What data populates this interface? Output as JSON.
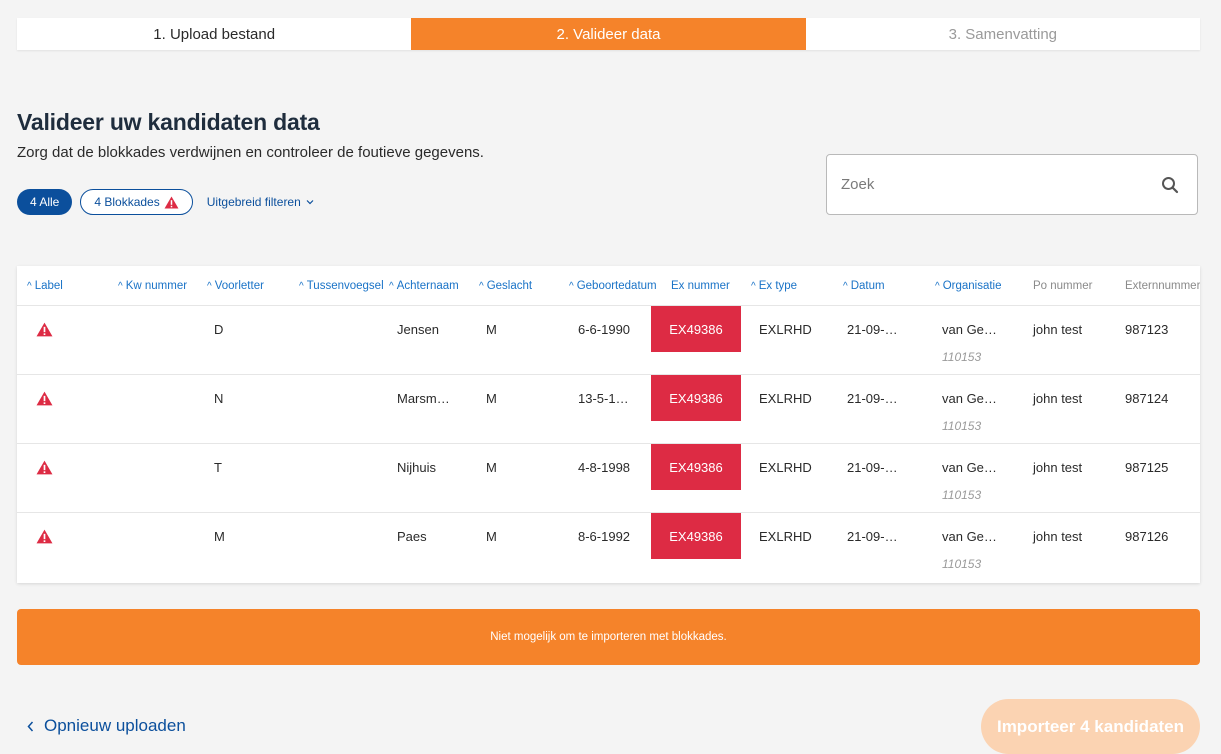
{
  "stepper": {
    "steps": [
      {
        "label": "1. Upload bestand",
        "state": "done"
      },
      {
        "label": "2. Valideer data",
        "state": "active"
      },
      {
        "label": "3. Samenvatting",
        "state": "inactive"
      }
    ]
  },
  "header": {
    "title": "Valideer uw kandidaten data",
    "subtitle": "Zorg dat de blokkades verdwijnen en controleer de foutieve gegevens."
  },
  "filters": {
    "all_label": "4 Alle",
    "blokkades_label": "4 Blokkades",
    "advanced_label": "Uitgebreid filteren"
  },
  "search": {
    "placeholder": "Zoek"
  },
  "table": {
    "columns": [
      {
        "label": "Label",
        "sortable": true
      },
      {
        "label": "Kw nummer",
        "sortable": true
      },
      {
        "label": "Voorletter",
        "sortable": true
      },
      {
        "label": "Tussenvoegsel",
        "sortable": true
      },
      {
        "label": "Achternaam",
        "sortable": true
      },
      {
        "label": "Geslacht",
        "sortable": true
      },
      {
        "label": "Geboortedatum",
        "sortable": true
      },
      {
        "label": "Ex nummer",
        "sortable": false
      },
      {
        "label": "Ex type",
        "sortable": true
      },
      {
        "label": "Datum",
        "sortable": true
      },
      {
        "label": "Organisatie",
        "sortable": true
      },
      {
        "label": "Po nummer",
        "sortable": false
      },
      {
        "label": "Externnummer",
        "sortable": false
      }
    ],
    "rows": [
      {
        "voorletter": "D",
        "achternaam": "Jensen",
        "geslacht": "M",
        "geboortedatum": "6-6-1990",
        "ex_nummer": "EX49386",
        "ex_type": "EXLRHD",
        "datum": "21-09-…",
        "organisatie": "van Ge…",
        "organisatie_id": "110153",
        "po_nummer": "john test",
        "externnummer": "987123"
      },
      {
        "voorletter": "N",
        "achternaam": "Marsm…",
        "geslacht": "M",
        "geboortedatum": "13-5-1…",
        "ex_nummer": "EX49386",
        "ex_type": "EXLRHD",
        "datum": "21-09-…",
        "organisatie": "van Ge…",
        "organisatie_id": "110153",
        "po_nummer": "john test",
        "externnummer": "987124"
      },
      {
        "voorletter": "T",
        "achternaam": "Nijhuis",
        "geslacht": "M",
        "geboortedatum": "4-8-1998",
        "ex_nummer": "EX49386",
        "ex_type": "EXLRHD",
        "datum": "21-09-…",
        "organisatie": "van Ge…",
        "organisatie_id": "110153",
        "po_nummer": "john test",
        "externnummer": "987125"
      },
      {
        "voorletter": "M",
        "achternaam": "Paes",
        "geslacht": "M",
        "geboortedatum": "8-6-1992",
        "ex_nummer": "EX49386",
        "ex_type": "EXLRHD",
        "datum": "21-09-…",
        "organisatie": "van Ge…",
        "organisatie_id": "110153",
        "po_nummer": "john test",
        "externnummer": "987126"
      }
    ]
  },
  "banner": {
    "message": "Niet mogelijk om te importeren met blokkades."
  },
  "footer": {
    "back_label": "Opnieuw uploaden",
    "import_label": "Importeer 4 kandidaten"
  },
  "colors": {
    "accent": "#f5832a",
    "primary": "#0b4f9c",
    "error": "#dd2b44"
  }
}
